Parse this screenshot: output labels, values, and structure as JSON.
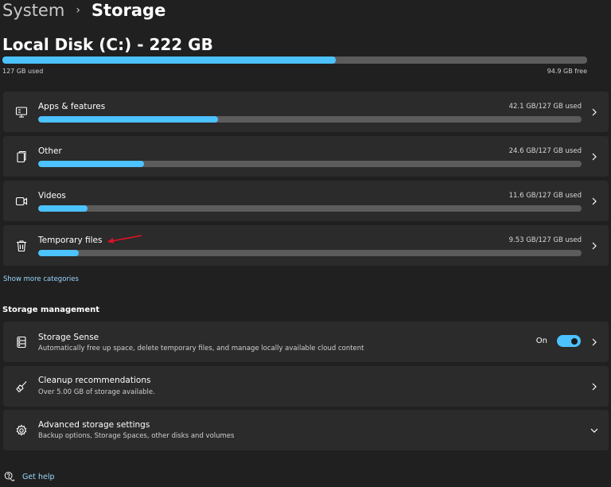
{
  "breadcrumb": {
    "parent": "System",
    "separator": "›",
    "current": "Storage"
  },
  "disk": {
    "title": "Local Disk (C:) - 222 GB",
    "used_label": "127 GB used",
    "free_label": "94.9 GB free",
    "used_fraction": 0.57
  },
  "categories": [
    {
      "label": "Apps & features",
      "value": "42.1 GB/127 GB used",
      "fraction": 0.331,
      "icon": "apps-icon"
    },
    {
      "label": "Other",
      "value": "24.6 GB/127 GB used",
      "fraction": 0.194,
      "icon": "file-icon"
    },
    {
      "label": "Videos",
      "value": "11.6 GB/127 GB used",
      "fraction": 0.091,
      "icon": "video-icon"
    },
    {
      "label": "Temporary files",
      "value": "9.53 GB/127 GB used",
      "fraction": 0.075,
      "icon": "trash-icon"
    }
  ],
  "show_more": "Show more categories",
  "management": {
    "title": "Storage management",
    "storage_sense": {
      "label": "Storage Sense",
      "description": "Automatically free up space, delete temporary files, and manage locally available cloud content",
      "toggle_label": "On",
      "enabled": true
    },
    "cleanup": {
      "label": "Cleanup recommendations",
      "description": "Over 5.00 GB of storage available."
    },
    "advanced": {
      "label": "Advanced storage settings",
      "description": "Backup options, Storage Spaces, other disks and volumes"
    }
  },
  "help": {
    "label": "Get help"
  },
  "colors": {
    "accent": "#4cc2ff",
    "background": "#202020",
    "card": "#2b2b2b",
    "track": "#5c5c5c",
    "annotation": "#e81123"
  }
}
